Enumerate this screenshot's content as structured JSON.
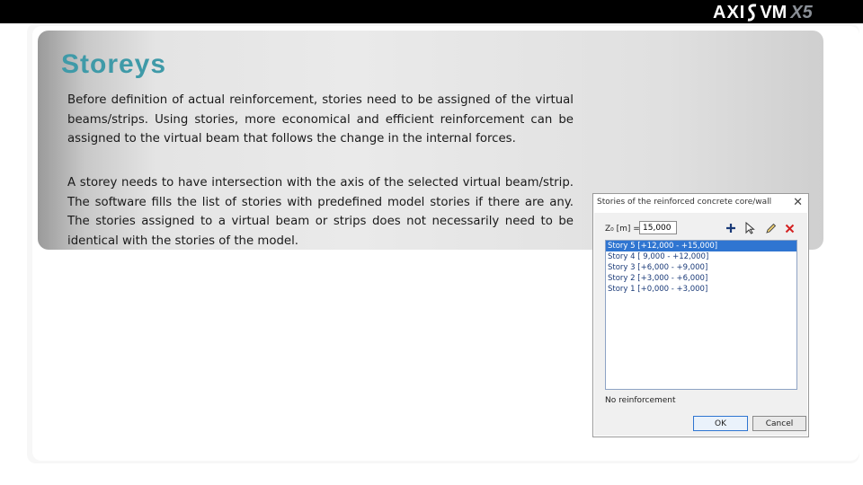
{
  "brand": {
    "logo_text_left": "AXI",
    "logo_text_right": "VM",
    "version": "X5"
  },
  "slide": {
    "title": "Storeys",
    "paragraph1": "Before definition of actual reinforcement, stories need to be assigned of the virtual beams/strips. Using stories, more economical and efficient reinforcement can be assigned to the virtual beam that follows the change in the internal forces.",
    "paragraph2": "A storey needs to have intersection with the axis of the selected virtual beam/strip. The software fills the list of stories with predefined model stories if there are any. The stories assigned to a virtual beam or strips does not necessarily need to be identical with the stories of the model."
  },
  "dialog": {
    "title": "Stories of the reinforced concrete core/wall",
    "close_symbol": "✕",
    "field_label": "Z₀ [m] =",
    "field_value": "15,000",
    "tools": [
      "add-icon",
      "pointer-icon",
      "edit-icon",
      "delete-icon"
    ],
    "stories": [
      "Story 5 [+12,000 - +15,000]",
      "Story 4 [ 9,000 - +12,000]",
      "Story 3 [+6,000 - +9,000]",
      "Story 2 [+3,000 - +6,000]",
      "Story 1 [+0,000 - +3,000]"
    ],
    "selected_index": 0,
    "status": "No reinforcement",
    "ok_label": "OK",
    "cancel_label": "Cancel"
  },
  "colors": {
    "title": "#3f9aa8",
    "selection": "#2f75d1",
    "add_icon": "#1a3a78",
    "delete_icon": "#d42020"
  }
}
